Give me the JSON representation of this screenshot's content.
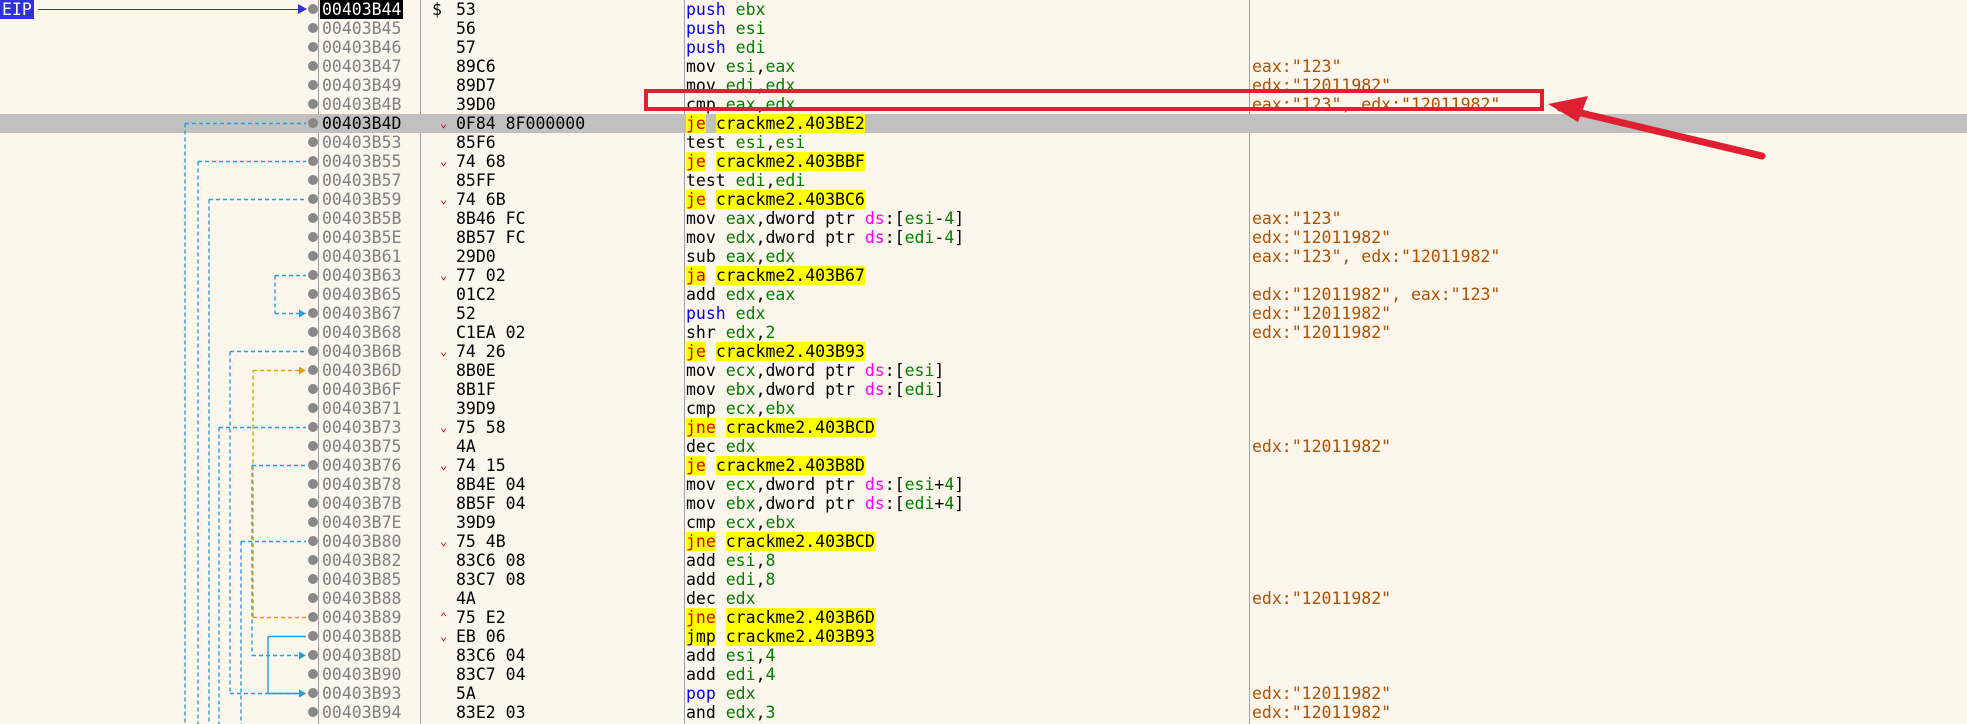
{
  "eip_label": "EIP",
  "rows": [
    {
      "addr": "00403B44",
      "mark": "$",
      "arrow": "",
      "bytes": "53",
      "ins": [
        [
          "mn-push",
          "push "
        ],
        [
          "reg",
          "ebx"
        ]
      ],
      "comment": ""
    },
    {
      "addr": "00403B45",
      "mark": "",
      "arrow": "",
      "bytes": "56",
      "ins": [
        [
          "mn-push",
          "push "
        ],
        [
          "reg",
          "esi"
        ]
      ],
      "comment": ""
    },
    {
      "addr": "00403B46",
      "mark": "",
      "arrow": "",
      "bytes": "57",
      "ins": [
        [
          "mn-push",
          "push "
        ],
        [
          "reg",
          "edi"
        ]
      ],
      "comment": ""
    },
    {
      "addr": "00403B47",
      "mark": "",
      "arrow": "",
      "bytes": "89C6",
      "ins": [
        [
          "op",
          "mov "
        ],
        [
          "reg",
          "esi"
        ],
        [
          "op",
          ","
        ],
        [
          "reg",
          "eax"
        ]
      ],
      "comment": "eax:\"123\""
    },
    {
      "addr": "00403B49",
      "mark": "",
      "arrow": "",
      "bytes": "89D7",
      "ins": [
        [
          "op",
          "mov "
        ],
        [
          "reg",
          "edi"
        ],
        [
          "op",
          ","
        ],
        [
          "reg",
          "edx"
        ]
      ],
      "comment": "edx:\"12011982\""
    },
    {
      "addr": "00403B4B",
      "mark": "",
      "arrow": "",
      "bytes": "39D0",
      "ins": [
        [
          "op",
          "cmp "
        ],
        [
          "reg",
          "eax"
        ],
        [
          "op",
          ","
        ],
        [
          "reg",
          "edx"
        ]
      ],
      "comment": "eax:\"123\", edx:\"12011982\""
    },
    {
      "addr": "00403B4D",
      "mark": "",
      "arrow": "⌄",
      "bytes": "0F84 8F000000",
      "ins": [
        [
          "mn-jcc",
          "je"
        ],
        [
          "op",
          " "
        ],
        [
          "tgt",
          "crackme2.403BE2"
        ]
      ],
      "comment": ""
    },
    {
      "addr": "00403B53",
      "mark": "",
      "arrow": "",
      "bytes": "85F6",
      "ins": [
        [
          "op",
          "test "
        ],
        [
          "reg",
          "esi"
        ],
        [
          "op",
          ","
        ],
        [
          "reg",
          "esi"
        ]
      ],
      "comment": ""
    },
    {
      "addr": "00403B55",
      "mark": "",
      "arrow": "⌄",
      "bytes": "74 68",
      "ins": [
        [
          "mn-jcc",
          "je"
        ],
        [
          "op",
          " "
        ],
        [
          "tgt",
          "crackme2.403BBF"
        ]
      ],
      "comment": ""
    },
    {
      "addr": "00403B57",
      "mark": "",
      "arrow": "",
      "bytes": "85FF",
      "ins": [
        [
          "op",
          "test "
        ],
        [
          "reg",
          "edi"
        ],
        [
          "op",
          ","
        ],
        [
          "reg",
          "edi"
        ]
      ],
      "comment": ""
    },
    {
      "addr": "00403B59",
      "mark": "",
      "arrow": "⌄",
      "bytes": "74 6B",
      "ins": [
        [
          "mn-jcc",
          "je"
        ],
        [
          "op",
          " "
        ],
        [
          "tgt",
          "crackme2.403BC6"
        ]
      ],
      "comment": ""
    },
    {
      "addr": "00403B5B",
      "mark": "",
      "arrow": "",
      "bytes": "8B46 FC",
      "ins": [
        [
          "op",
          "mov "
        ],
        [
          "reg",
          "eax"
        ],
        [
          "op",
          ",dword ptr "
        ],
        [
          "seg",
          "ds"
        ],
        [
          "op",
          ":["
        ],
        [
          "reg",
          "esi"
        ],
        [
          "op",
          "-"
        ],
        [
          "num",
          "4"
        ],
        [
          "op",
          "]"
        ]
      ],
      "comment": "eax:\"123\""
    },
    {
      "addr": "00403B5E",
      "mark": "",
      "arrow": "",
      "bytes": "8B57 FC",
      "ins": [
        [
          "op",
          "mov "
        ],
        [
          "reg",
          "edx"
        ],
        [
          "op",
          ",dword ptr "
        ],
        [
          "seg",
          "ds"
        ],
        [
          "op",
          ":["
        ],
        [
          "reg",
          "edi"
        ],
        [
          "op",
          "-"
        ],
        [
          "num",
          "4"
        ],
        [
          "op",
          "]"
        ]
      ],
      "comment": "edx:\"12011982\""
    },
    {
      "addr": "00403B61",
      "mark": "",
      "arrow": "",
      "bytes": "29D0",
      "ins": [
        [
          "op",
          "sub "
        ],
        [
          "reg",
          "eax"
        ],
        [
          "op",
          ","
        ],
        [
          "reg",
          "edx"
        ]
      ],
      "comment": "eax:\"123\", edx:\"12011982\""
    },
    {
      "addr": "00403B63",
      "mark": "",
      "arrow": "⌄",
      "bytes": "77 02",
      "ins": [
        [
          "mn-jcc",
          "ja"
        ],
        [
          "op",
          " "
        ],
        [
          "tgt",
          "crackme2.403B67"
        ]
      ],
      "comment": ""
    },
    {
      "addr": "00403B65",
      "mark": "",
      "arrow": "",
      "bytes": "01C2",
      "ins": [
        [
          "op",
          "add "
        ],
        [
          "reg",
          "edx"
        ],
        [
          "op",
          ","
        ],
        [
          "reg",
          "eax"
        ]
      ],
      "comment": "edx:\"12011982\", eax:\"123\""
    },
    {
      "addr": "00403B67",
      "mark": "",
      "arrow": "",
      "bytes": "52",
      "ins": [
        [
          "mn-push",
          "push "
        ],
        [
          "reg",
          "edx"
        ]
      ],
      "comment": "edx:\"12011982\""
    },
    {
      "addr": "00403B68",
      "mark": "",
      "arrow": "",
      "bytes": "C1EA 02",
      "ins": [
        [
          "op",
          "shr "
        ],
        [
          "reg",
          "edx"
        ],
        [
          "op",
          ","
        ],
        [
          "num",
          "2"
        ]
      ],
      "comment": "edx:\"12011982\""
    },
    {
      "addr": "00403B6B",
      "mark": "",
      "arrow": "⌄",
      "bytes": "74 26",
      "ins": [
        [
          "mn-jcc",
          "je"
        ],
        [
          "op",
          " "
        ],
        [
          "tgt",
          "crackme2.403B93"
        ]
      ],
      "comment": ""
    },
    {
      "addr": "00403B6D",
      "mark": "",
      "arrow": "",
      "bytes": "8B0E",
      "ins": [
        [
          "op",
          "mov "
        ],
        [
          "reg",
          "ecx"
        ],
        [
          "op",
          ",dword ptr "
        ],
        [
          "seg",
          "ds"
        ],
        [
          "op",
          ":["
        ],
        [
          "reg",
          "esi"
        ],
        [
          "op",
          "]"
        ]
      ],
      "comment": ""
    },
    {
      "addr": "00403B6F",
      "mark": "",
      "arrow": "",
      "bytes": "8B1F",
      "ins": [
        [
          "op",
          "mov "
        ],
        [
          "reg",
          "ebx"
        ],
        [
          "op",
          ",dword ptr "
        ],
        [
          "seg",
          "ds"
        ],
        [
          "op",
          ":["
        ],
        [
          "reg",
          "edi"
        ],
        [
          "op",
          "]"
        ]
      ],
      "comment": ""
    },
    {
      "addr": "00403B71",
      "mark": "",
      "arrow": "",
      "bytes": "39D9",
      "ins": [
        [
          "op",
          "cmp "
        ],
        [
          "reg",
          "ecx"
        ],
        [
          "op",
          ","
        ],
        [
          "reg",
          "ebx"
        ]
      ],
      "comment": ""
    },
    {
      "addr": "00403B73",
      "mark": "",
      "arrow": "⌄",
      "bytes": "75 58",
      "ins": [
        [
          "mn-jcc",
          "jne"
        ],
        [
          "op",
          " "
        ],
        [
          "tgt",
          "crackme2.403BCD"
        ]
      ],
      "comment": ""
    },
    {
      "addr": "00403B75",
      "mark": "",
      "arrow": "",
      "bytes": "4A",
      "ins": [
        [
          "op",
          "dec "
        ],
        [
          "reg",
          "edx"
        ]
      ],
      "comment": "edx:\"12011982\""
    },
    {
      "addr": "00403B76",
      "mark": "",
      "arrow": "⌄",
      "bytes": "74 15",
      "ins": [
        [
          "mn-jcc",
          "je"
        ],
        [
          "op",
          " "
        ],
        [
          "tgt",
          "crackme2.403B8D"
        ]
      ],
      "comment": ""
    },
    {
      "addr": "00403B78",
      "mark": "",
      "arrow": "",
      "bytes": "8B4E 04",
      "ins": [
        [
          "op",
          "mov "
        ],
        [
          "reg",
          "ecx"
        ],
        [
          "op",
          ",dword ptr "
        ],
        [
          "seg",
          "ds"
        ],
        [
          "op",
          ":["
        ],
        [
          "reg",
          "esi"
        ],
        [
          "op",
          "+"
        ],
        [
          "num",
          "4"
        ],
        [
          "op",
          "]"
        ]
      ],
      "comment": ""
    },
    {
      "addr": "00403B7B",
      "mark": "",
      "arrow": "",
      "bytes": "8B5F 04",
      "ins": [
        [
          "op",
          "mov "
        ],
        [
          "reg",
          "ebx"
        ],
        [
          "op",
          ",dword ptr "
        ],
        [
          "seg",
          "ds"
        ],
        [
          "op",
          ":["
        ],
        [
          "reg",
          "edi"
        ],
        [
          "op",
          "+"
        ],
        [
          "num",
          "4"
        ],
        [
          "op",
          "]"
        ]
      ],
      "comment": ""
    },
    {
      "addr": "00403B7E",
      "mark": "",
      "arrow": "",
      "bytes": "39D9",
      "ins": [
        [
          "op",
          "cmp "
        ],
        [
          "reg",
          "ecx"
        ],
        [
          "op",
          ","
        ],
        [
          "reg",
          "ebx"
        ]
      ],
      "comment": ""
    },
    {
      "addr": "00403B80",
      "mark": "",
      "arrow": "⌄",
      "bytes": "75 4B",
      "ins": [
        [
          "mn-jcc",
          "jne"
        ],
        [
          "op",
          " "
        ],
        [
          "tgt",
          "crackme2.403BCD"
        ]
      ],
      "comment": ""
    },
    {
      "addr": "00403B82",
      "mark": "",
      "arrow": "",
      "bytes": "83C6 08",
      "ins": [
        [
          "op",
          "add "
        ],
        [
          "reg",
          "esi"
        ],
        [
          "op",
          ","
        ],
        [
          "num",
          "8"
        ]
      ],
      "comment": ""
    },
    {
      "addr": "00403B85",
      "mark": "",
      "arrow": "",
      "bytes": "83C7 08",
      "ins": [
        [
          "op",
          "add "
        ],
        [
          "reg",
          "edi"
        ],
        [
          "op",
          ","
        ],
        [
          "num",
          "8"
        ]
      ],
      "comment": ""
    },
    {
      "addr": "00403B88",
      "mark": "",
      "arrow": "",
      "bytes": "4A",
      "ins": [
        [
          "op",
          "dec "
        ],
        [
          "reg",
          "edx"
        ]
      ],
      "comment": "edx:\"12011982\""
    },
    {
      "addr": "00403B89",
      "mark": "",
      "arrow": "⌃",
      "bytes": "75 E2",
      "ins": [
        [
          "mn-jcc",
          "jne"
        ],
        [
          "op",
          " "
        ],
        [
          "tgt",
          "crackme2.403B6D"
        ]
      ],
      "comment": ""
    },
    {
      "addr": "00403B8B",
      "mark": "",
      "arrow": "⌄",
      "bytes": "EB 06",
      "ins": [
        [
          "mn-jmp",
          "jmp"
        ],
        [
          "op",
          " "
        ],
        [
          "tgt",
          "crackme2.403B93"
        ]
      ],
      "comment": ""
    },
    {
      "addr": "00403B8D",
      "mark": "",
      "arrow": "",
      "bytes": "83C6 04",
      "ins": [
        [
          "op",
          "add "
        ],
        [
          "reg",
          "esi"
        ],
        [
          "op",
          ","
        ],
        [
          "num",
          "4"
        ]
      ],
      "comment": ""
    },
    {
      "addr": "00403B90",
      "mark": "",
      "arrow": "",
      "bytes": "83C7 04",
      "ins": [
        [
          "op",
          "add "
        ],
        [
          "reg",
          "edi"
        ],
        [
          "op",
          ","
        ],
        [
          "num",
          "4"
        ]
      ],
      "comment": ""
    },
    {
      "addr": "00403B93",
      "mark": "",
      "arrow": "",
      "bytes": "5A",
      "ins": [
        [
          "mn-pop",
          "pop "
        ],
        [
          "reg",
          "edx"
        ]
      ],
      "comment": "edx:\"12011982\""
    },
    {
      "addr": "00403B94",
      "mark": "",
      "arrow": "",
      "bytes": "83E2 03",
      "ins": [
        [
          "op",
          "and "
        ],
        [
          "reg",
          "edx"
        ],
        [
          "op",
          ","
        ],
        [
          "num",
          "3"
        ]
      ],
      "comment": "edx:\"12011982\""
    }
  ],
  "current_row_index": 6,
  "eip_row_index": 0,
  "highlight_row_index": 5,
  "colors": {
    "eip": "#3030e0",
    "callout": "#e02030",
    "jump_line": "#1ea0e0",
    "loop_line": "#e0a000",
    "current_row": "#c0c0c0"
  },
  "icons": {
    "row_marker": "breakpoint-dot-icon",
    "jump_arrow": "chevron-down-icon"
  }
}
